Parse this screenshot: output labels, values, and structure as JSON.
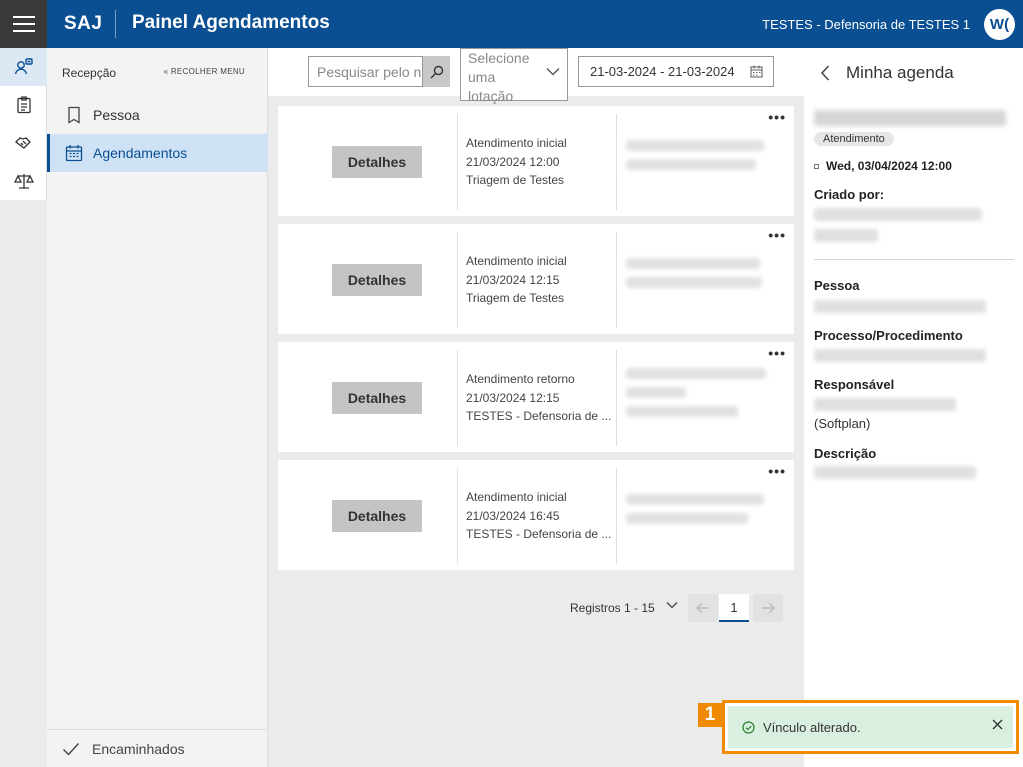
{
  "header": {
    "brand": "SAJ",
    "title": "Painel Agendamentos",
    "user_org": "TESTES - Defensoria de TESTES 1",
    "avatar_initials": "W("
  },
  "colors": {
    "primary": "#0a4f92",
    "toast_bg": "#d9efdf",
    "highlight": "#f08a00"
  },
  "rail": {
    "icons": [
      "person-search-icon",
      "clipboard-icon",
      "handshake-icon",
      "scales-icon"
    ]
  },
  "sidemenu": {
    "section": "Recepção",
    "collapse_label": "RECOLHER MENU",
    "items": [
      {
        "label": "Pessoa",
        "icon": "book-icon"
      },
      {
        "label": "Agendamentos",
        "icon": "calendar-icon"
      }
    ],
    "footer": "Encaminhados"
  },
  "filters": {
    "search_placeholder": "Pesquisar pelo n",
    "select_placeholder": [
      "Selecione",
      "uma",
      "lotação"
    ],
    "date_range": "21-03-2024 - 21-03-2024"
  },
  "cards": [
    {
      "button": "Detalhes",
      "type": "Atendimento inicial",
      "datetime": "21/03/2024 12:00",
      "location": "Triagem de Testes"
    },
    {
      "button": "Detalhes",
      "type": "Atendimento inicial",
      "datetime": "21/03/2024 12:15",
      "location": "Triagem de Testes"
    },
    {
      "button": "Detalhes",
      "type": "Atendimento retorno",
      "datetime": "21/03/2024 12:15",
      "location": "TESTES - Defensoria de ..."
    },
    {
      "button": "Detalhes",
      "type": "Atendimento inicial",
      "datetime": "21/03/2024 16:45",
      "location": "TESTES - Defensoria de ..."
    }
  ],
  "pagination": {
    "label": "Registros 1 - 15",
    "current_page": "1"
  },
  "panel": {
    "title": "Minha agenda",
    "tag": "Atendimento",
    "date": "Wed, 03/04/2024 12:00",
    "created_by_label": "Criado por:",
    "person_label": "Pessoa",
    "process_label": "Processo/Procedimento",
    "responsible_label": "Responsável",
    "responsible_suffix": "(Softplan)",
    "description_label": "Descrição"
  },
  "toast": {
    "marker": "1",
    "message": "Vínculo alterado."
  }
}
